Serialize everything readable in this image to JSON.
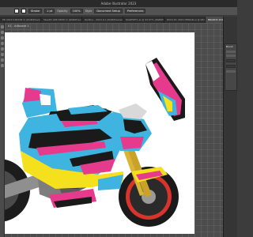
{
  "app": {
    "title": "Adobe Illustrator 2023"
  },
  "options_bar": {
    "stroke_field": "Stroke",
    "stroke_weight": "1 pt",
    "opacity_label": "Opacity",
    "opacity_value": "100%",
    "style_label": "Style",
    "document_setup_button": "Document Setup",
    "preferences_button": "Preferences"
  },
  "tabs": [
    {
      "label": "PR 2024 K-BOOM Ci (RGB/Preview)",
      "active": false
    },
    {
      "label": "Stealth GPK KB3D Ci (RGB/Preview)",
      "active": false
    },
    {
      "label": "Redline - 2024 K-1 (RGB/Preview)",
      "active": false
    },
    {
      "label": "RAGESET1.ai @ 93.97% (RGB/Preview)",
      "active": false
    },
    {
      "label": "RSV4 R1 2024 DESIGN.ai @ 98.6% (CMYK/Preview)",
      "active": false
    },
    {
      "label": "BRANDS 2024 CARBONTECH APRILIA.ai* @ 1.28% (RGB/Preview)",
      "active": true
    }
  ],
  "artboard": {
    "label": "01 - Artboard 1"
  },
  "panel": {
    "title": "Brush"
  },
  "colors": {
    "fairing_blue": "#3fb4e0",
    "fairing_pink": "#e63a8c",
    "fairing_yellow": "#f4e01d",
    "fairing_black": "#1a1a1a",
    "frame_grey": "#8f8f8f",
    "wheel_red": "#d8342c"
  },
  "icons": [
    "tool-icon",
    "panel-icon"
  ]
}
